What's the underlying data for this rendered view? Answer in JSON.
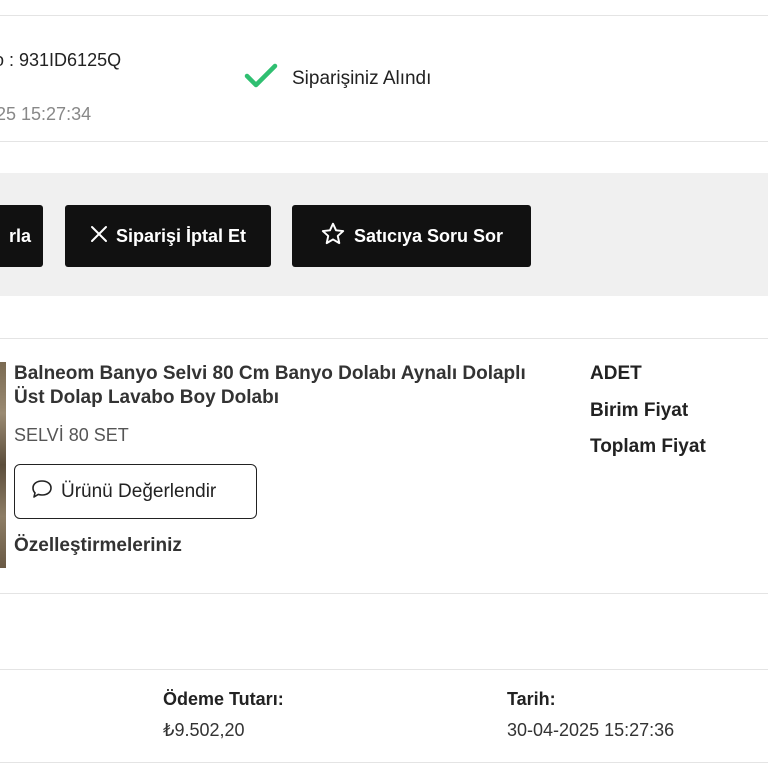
{
  "order": {
    "code": "o : 931ID6125Q",
    "date": "25 15:27:34",
    "status": "Siparişiniz Alındı"
  },
  "actions": {
    "partial_label": "rla",
    "cancel_label": "Siparişi İptal Et",
    "ask_seller_label": "Satıcıya Soru Sor"
  },
  "product": {
    "title": "Balneom Banyo Selvi 80 Cm Banyo Dolabı Aynalı Dolaplı Üst Dolap Lavabo Boy Dolabı",
    "variant": "SELVİ 80 SET",
    "review_label": "Ürünü Değerlendir",
    "customizations_label": "Özelleştirmeleriniz",
    "quantity_label": "ADET",
    "unit_price_label": "Birim Fiyat",
    "total_price_label": "Toplam Fiyat"
  },
  "payment": {
    "amount_label": "Ödeme Tutarı:",
    "amount": "₺9.502,20",
    "date_label": "Tarih:",
    "date": "30-04-2025 15:27:36"
  },
  "colors": {
    "status_check": "#2fbf71",
    "button_bg": "#111111",
    "action_bar_bg": "#f0f0f0"
  },
  "icons": {
    "status": "check-icon",
    "cancel": "close-icon",
    "ask_seller": "star-icon",
    "review": "comment-icon"
  }
}
